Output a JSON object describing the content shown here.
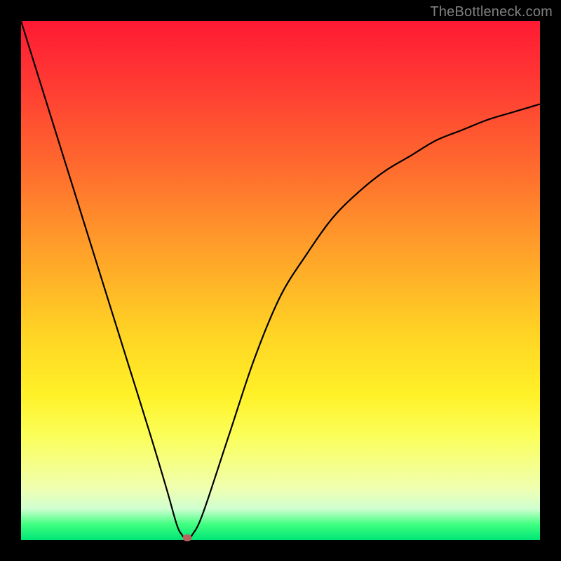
{
  "watermark": "TheBottleneck.com",
  "chart_data": {
    "type": "line",
    "title": "",
    "xlabel": "",
    "ylabel": "",
    "xlim": [
      0,
      100
    ],
    "ylim": [
      0,
      100
    ],
    "series": [
      {
        "name": "bottleneck-curve",
        "x": [
          0,
          5,
          10,
          15,
          20,
          25,
          28,
          30,
          31,
          32,
          33,
          35,
          40,
          45,
          50,
          55,
          60,
          65,
          70,
          75,
          80,
          85,
          90,
          95,
          100
        ],
        "values": [
          100,
          84,
          68,
          52,
          36,
          20,
          10,
          3,
          1,
          0,
          1,
          5,
          20,
          35,
          47,
          55,
          62,
          67,
          71,
          74,
          77,
          79,
          81,
          82.5,
          84
        ]
      }
    ],
    "marker": {
      "x": 32,
      "y": 0,
      "color": "#bb625f"
    },
    "gradient_colors": {
      "top": "#ff1a33",
      "mid": "#ffe035",
      "bottom": "#00e676"
    }
  }
}
